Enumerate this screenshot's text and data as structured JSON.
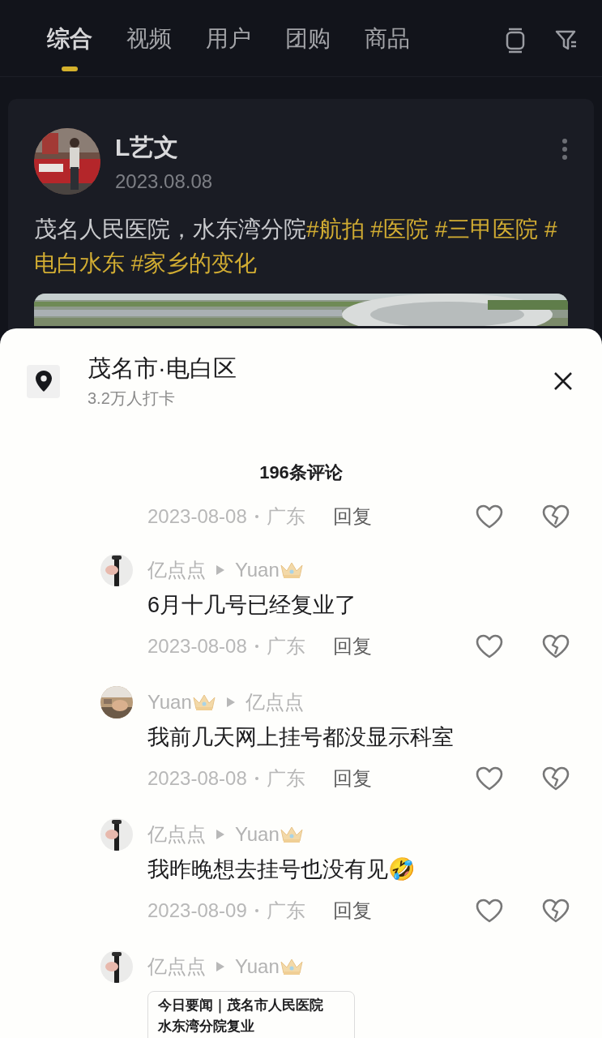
{
  "tabs": [
    {
      "label": "综合",
      "selected": true
    },
    {
      "label": "视频",
      "selected": false
    },
    {
      "label": "用户",
      "selected": false
    },
    {
      "label": "团购",
      "selected": false
    },
    {
      "label": "商品",
      "selected": false
    }
  ],
  "post": {
    "author": "L艺文",
    "date": "2023.08.08",
    "text_parts": [
      {
        "kind": "plain",
        "text": "茂名人民医院，水东湾分院"
      },
      {
        "kind": "hashtag",
        "text": "#航拍"
      },
      {
        "kind": "hashtag",
        "text": "#医院"
      },
      {
        "kind": "hashtag",
        "text": "#三甲医院"
      },
      {
        "kind": "hashtag",
        "text": "#电白水东"
      },
      {
        "kind": "hashtag",
        "text": "#家乡的变化"
      }
    ]
  },
  "sheet": {
    "location": "茂名市·电白区",
    "checkins": "3.2万人打卡",
    "comment_count": "196条评论"
  },
  "comments": [
    {
      "kind": "meta_only",
      "date": "2023-08-08",
      "region": "广东",
      "reply": "回复"
    },
    {
      "kind": "reply",
      "author": "亿点点",
      "author_crown": false,
      "reply_to": "Yuan",
      "reply_to_crown": true,
      "text": "6月十几号已经复业了",
      "date": "2023-08-08",
      "region": "广东",
      "reply": "回复"
    },
    {
      "kind": "reply",
      "author": "Yuan",
      "author_crown": true,
      "reply_to": "亿点点",
      "reply_to_crown": false,
      "text": "我前几天网上挂号都没显示科室",
      "date": "2023-08-08",
      "region": "广东",
      "reply": "回复"
    },
    {
      "kind": "reply",
      "author": "亿点点",
      "author_crown": false,
      "reply_to": "Yuan",
      "reply_to_crown": true,
      "text": "我昨晚想去挂号也没有见🤣",
      "date": "2023-08-09",
      "region": "广东",
      "reply": "回复"
    },
    {
      "kind": "link_reply",
      "author": "亿点点",
      "author_crown": false,
      "reply_to": "Yuan",
      "reply_to_crown": true,
      "card_lines": [
        "今日要闻｜茂名市人民医院",
        "水东湾分院复业"
      ]
    }
  ]
}
